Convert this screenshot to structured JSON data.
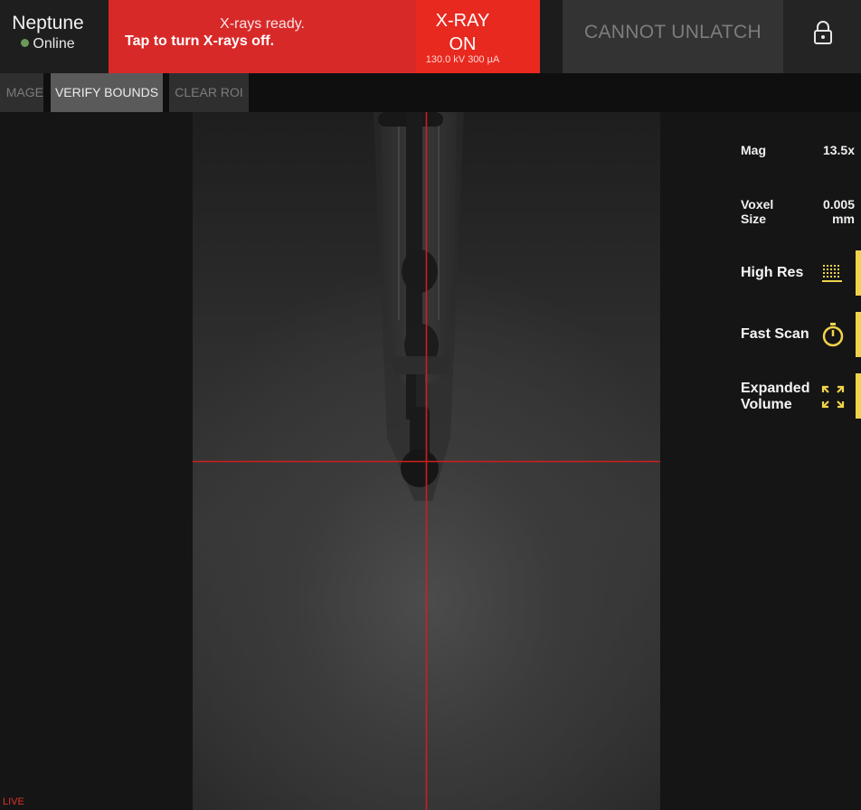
{
  "device": {
    "name": "Neptune",
    "status": "Online",
    "status_color": "#6a9a58"
  },
  "xray_banner": {
    "line1": "X-rays ready.",
    "line2": "Tap to turn X-rays off.",
    "color": "#d82929"
  },
  "xray_button": {
    "title_line1": "X-RAY",
    "title_line2": "ON",
    "readout": "130.0 kV 300 µA",
    "color": "#e8291f"
  },
  "unlatch": {
    "label": "CANNOT UNLATCH"
  },
  "lock": {
    "icon": "lock-icon"
  },
  "toolbar": {
    "buttons": [
      {
        "label": "MAGE"
      },
      {
        "label": "VERIFY BOUNDS"
      },
      {
        "label": "CLEAR ROI"
      }
    ]
  },
  "viewer": {
    "live_label": "LIVE",
    "crosshair_color": "#cc1f1f"
  },
  "stats": {
    "mag_label": "Mag",
    "mag_value": "13.5x",
    "voxel_label_line1": "Voxel",
    "voxel_label_line2": "Size",
    "voxel_value_line1": "0.005",
    "voxel_value_line2": "mm"
  },
  "modes": [
    {
      "label_line1": "High Res",
      "label_line2": "",
      "icon": "grid-icon"
    },
    {
      "label_line1": "Fast Scan",
      "label_line2": "",
      "icon": "stopwatch-icon"
    },
    {
      "label_line1": "Expanded",
      "label_line2": "Volume",
      "icon": "expand-icon"
    }
  ],
  "accent_color": "#f1d24b"
}
